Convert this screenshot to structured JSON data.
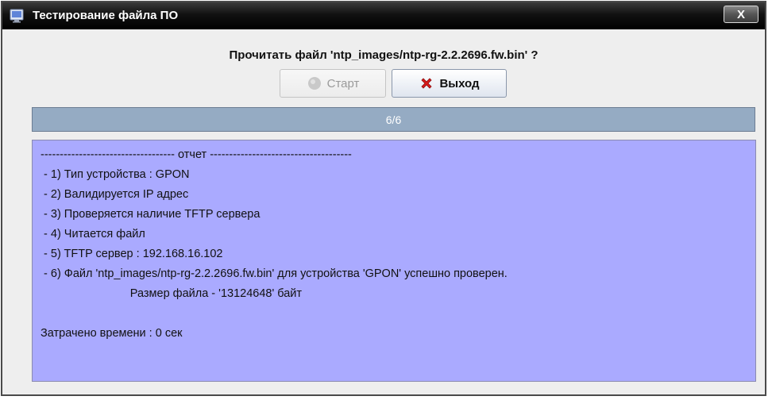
{
  "window": {
    "title": "Тестирование файла ПО",
    "close_label": "X"
  },
  "dialog": {
    "question": "Прочитать файл 'ntp_images/ntp-rg-2.2.2696.fw.bin' ?",
    "start_label": "Старт",
    "exit_label": "Выход"
  },
  "progress": {
    "text": "6/6",
    "fraction": 1.0
  },
  "report": {
    "lines": [
      "----------------------------------- отчет -------------------------------------",
      " - 1) Тип устройства : GPON",
      " - 2) Валидируется IP адрес",
      " - 3) Проверяется наличие TFTP сервера",
      " - 4) Читается файл",
      " - 5) TFTP сервер : 192.168.16.102",
      " - 6) Файл 'ntp_images/ntp-rg-2.2.2696.fw.bin' для устройства 'GPON' успешно проверен.",
      "                            Размер файла - '13124648' байт",
      "",
      "Затрачено времени : 0 сек"
    ]
  },
  "colors": {
    "report_bg": "#aaaaff",
    "progress_bg": "#9aafc7",
    "titlebar": "#000000"
  },
  "icons": {
    "title": "app-window-icon",
    "start": "gray-circle-icon",
    "exit": "red-x-icon"
  }
}
